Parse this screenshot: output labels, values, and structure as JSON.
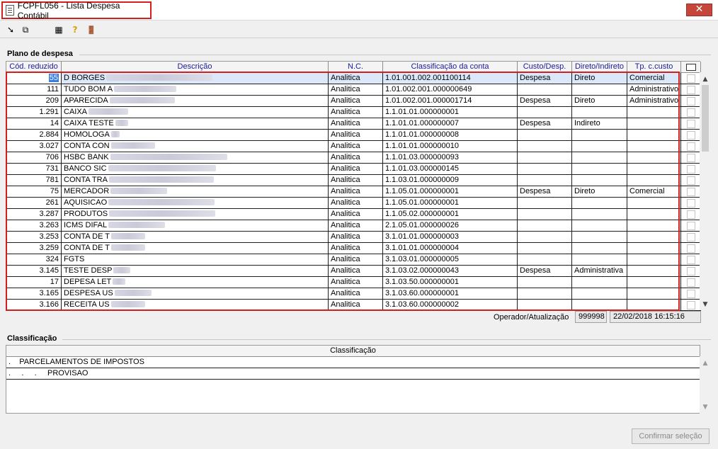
{
  "window": {
    "title": "FCPFL056 - Lista Despesa Contábil",
    "close_label": "✕"
  },
  "toolbar": {
    "buttons": [
      {
        "icon": "arrow-icon",
        "glyph": "➘"
      },
      {
        "icon": "windows-icon",
        "glyph": "⧉"
      },
      {
        "icon": "grid-icon",
        "glyph": "▦"
      },
      {
        "icon": "help-icon",
        "glyph": "?"
      },
      {
        "icon": "exit-door-icon",
        "glyph": "🚪"
      }
    ]
  },
  "plano": {
    "group_title": "Plano de despesa",
    "columns": [
      "Cód. reduzido",
      "Descrição",
      "N.C.",
      "Classificação da conta",
      "Custo/Desp.",
      "Direto/Indireto",
      "Tp. c.custo"
    ],
    "header_checkbox": "",
    "rows": [
      {
        "cod": "55",
        "desc": "D BORGES",
        "nc": "Analitica",
        "classif": "1.01.001.002.001100114",
        "custo": "Despesa",
        "direto": "Direto",
        "tp": "Comercial"
      },
      {
        "cod": "111",
        "desc": "TUDO BOM A",
        "nc": "Analitica",
        "classif": "1.01.002.001.000000649",
        "custo": "",
        "direto": "",
        "tp": "Administrativo"
      },
      {
        "cod": "209",
        "desc": "APARECIDA",
        "nc": "Analitica",
        "classif": "1.01.002.001.000001714",
        "custo": "Despesa",
        "direto": "Direto",
        "tp": "Administrativo"
      },
      {
        "cod": "1.291",
        "desc": "CAIXA",
        "nc": "Analitica",
        "classif": "1.1.01.01.000000001",
        "custo": "",
        "direto": "",
        "tp": ""
      },
      {
        "cod": "14",
        "desc": "CAIXA TESTE",
        "nc": "Analitica",
        "classif": "1.1.01.01.000000007",
        "custo": "Despesa",
        "direto": "Indireto",
        "tp": ""
      },
      {
        "cod": "2.884",
        "desc": "HOMOLOGA",
        "nc": "Analitica",
        "classif": "1.1.01.01.000000008",
        "custo": "",
        "direto": "",
        "tp": ""
      },
      {
        "cod": "3.027",
        "desc": "CONTA CON",
        "nc": "Analitica",
        "classif": "1.1.01.01.000000010",
        "custo": "",
        "direto": "",
        "tp": ""
      },
      {
        "cod": "706",
        "desc": "HSBC BANK",
        "nc": "Analitica",
        "classif": "1.1.01.03.000000093",
        "custo": "",
        "direto": "",
        "tp": ""
      },
      {
        "cod": "731",
        "desc": "BANCO SIC",
        "nc": "Analitica",
        "classif": "1.1.01.03.000000145",
        "custo": "",
        "direto": "",
        "tp": ""
      },
      {
        "cod": "781",
        "desc": "CONTA TRA",
        "nc": "Analitica",
        "classif": "1.1.03.01.000000009",
        "custo": "",
        "direto": "",
        "tp": ""
      },
      {
        "cod": "75",
        "desc": "MERCADOR",
        "nc": "Analitica",
        "classif": "1.1.05.01.000000001",
        "custo": "Despesa",
        "direto": "Direto",
        "tp": "Comercial"
      },
      {
        "cod": "261",
        "desc": "AQUISICAO",
        "nc": "Analitica",
        "classif": "1.1.05.01.000000001",
        "custo": "",
        "direto": "",
        "tp": ""
      },
      {
        "cod": "3.287",
        "desc": "PRODUTOS",
        "nc": "Analitica",
        "classif": "1.1.05.02.000000001",
        "custo": "",
        "direto": "",
        "tp": ""
      },
      {
        "cod": "3.263",
        "desc": "ICMS DIFAL",
        "nc": "Analitica",
        "classif": "2.1.05.01.000000026",
        "custo": "",
        "direto": "",
        "tp": ""
      },
      {
        "cod": "3.253",
        "desc": "CONTA DE T",
        "nc": "Analitica",
        "classif": "3.1.01.01.000000003",
        "custo": "",
        "direto": "",
        "tp": ""
      },
      {
        "cod": "3.259",
        "desc": "CONTA DE T",
        "nc": "Analitica",
        "classif": "3.1.01.01.000000004",
        "custo": "",
        "direto": "",
        "tp": ""
      },
      {
        "cod": "324",
        "desc": "FGTS",
        "nc": "Analitica",
        "classif": "3.1.03.01.000000005",
        "custo": "",
        "direto": "",
        "tp": ""
      },
      {
        "cod": "3.145",
        "desc": "TESTE DESP",
        "nc": "Analitica",
        "classif": "3.1.03.02.000000043",
        "custo": "Despesa",
        "direto": "Administrativa",
        "tp": ""
      },
      {
        "cod": "17",
        "desc": "DEPESA LET",
        "nc": "Analitica",
        "classif": "3.1.03.50.000000001",
        "custo": "",
        "direto": "",
        "tp": ""
      },
      {
        "cod": "3.165",
        "desc": "DESPESA US",
        "nc": "Analitica",
        "classif": "3.1.03.60.000000001",
        "custo": "",
        "direto": "",
        "tp": ""
      },
      {
        "cod": "3.166",
        "desc": "RECEITA US",
        "nc": "Analitica",
        "classif": "3.1.03.60.000000002",
        "custo": "",
        "direto": "",
        "tp": ""
      }
    ],
    "operador_label": "Operador/Atualização",
    "operador_id": "999998",
    "atualizacao": "22/02/2018 16:15:16"
  },
  "classificacao": {
    "group_title": "Classificação",
    "column": "Classificação",
    "rows": [
      ".    PARCELAMENTOS DE IMPOSTOS",
      ".     .     .     PROVISAO"
    ]
  },
  "confirm_label": "Confirmar seleção"
}
